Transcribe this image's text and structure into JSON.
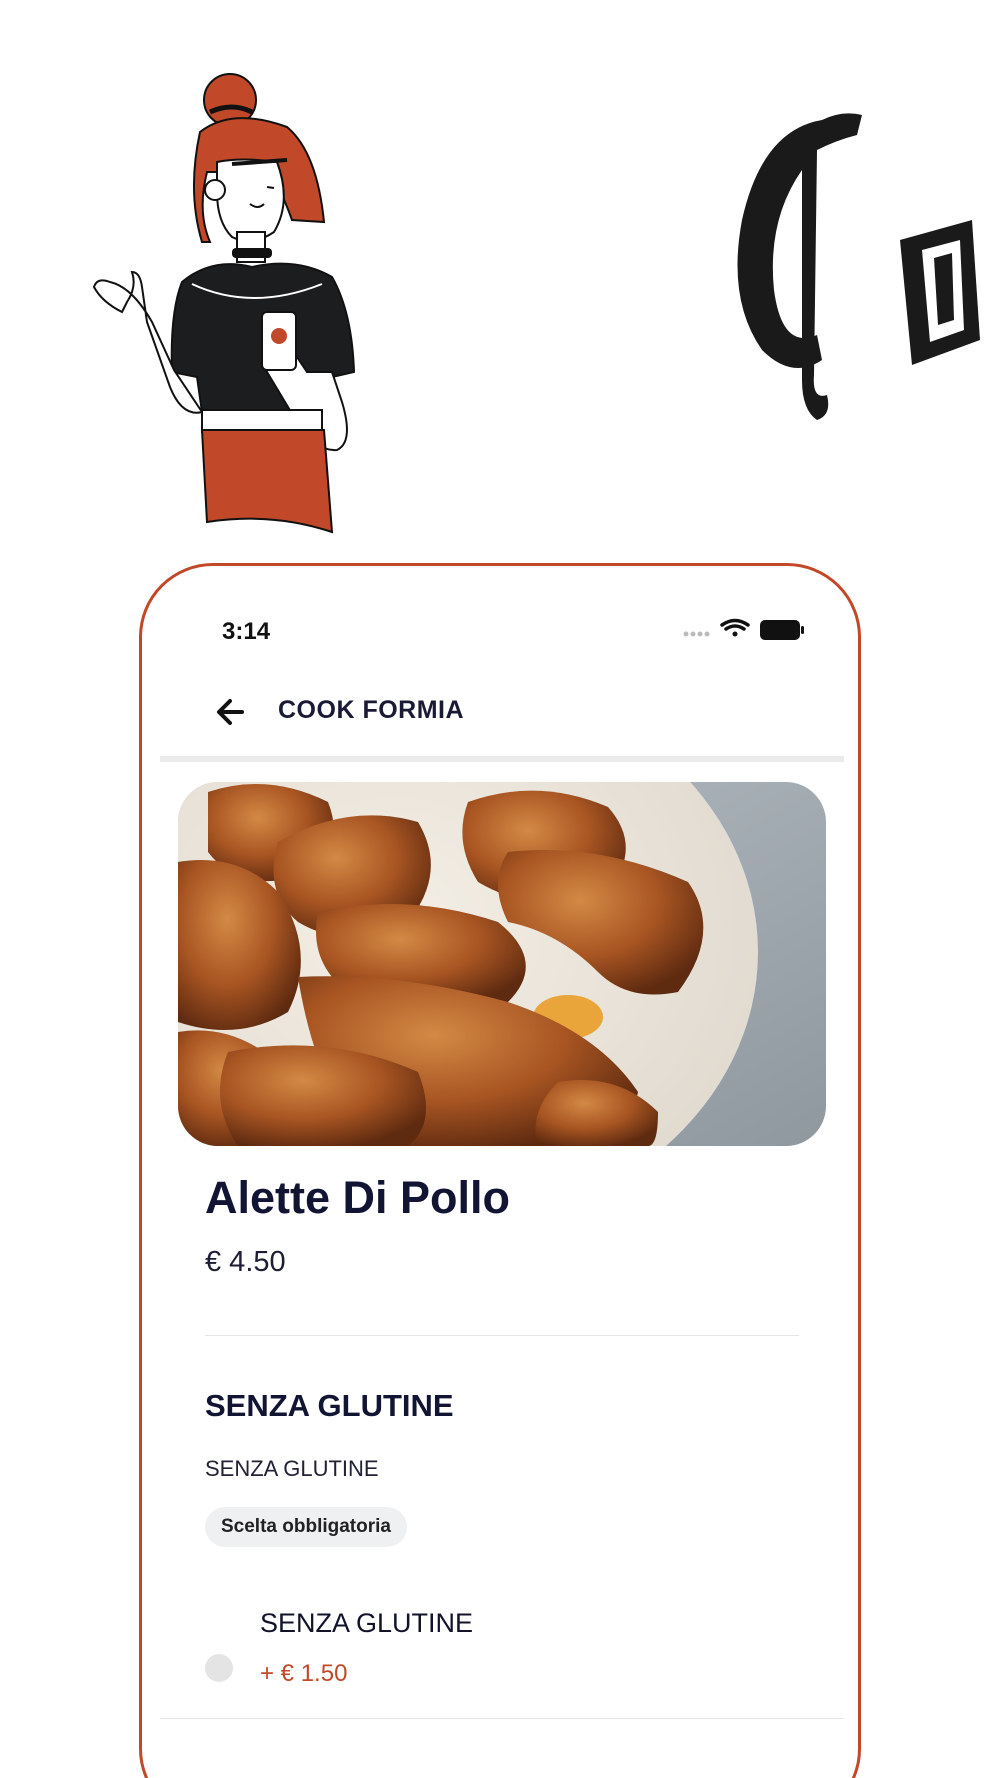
{
  "status_bar": {
    "time": "3:14"
  },
  "header": {
    "title": "COOK FORMIA"
  },
  "product": {
    "name": "Alette Di Pollo",
    "price": "€ 4.50"
  },
  "option_group": {
    "title": "SENZA GLUTINE",
    "subtitle": "SENZA GLUTINE",
    "badge": "Scelta obbligatoria",
    "options": [
      {
        "label": "SENZA GLUTINE",
        "price": "+ € 1.50",
        "selected": false
      }
    ]
  },
  "colors": {
    "accent": "#c1492a",
    "text_dark": "#121433",
    "divider": "#ebebeb"
  },
  "icons": [
    "signal-icon",
    "wifi-icon",
    "battery-icon",
    "back-arrow-icon"
  ]
}
